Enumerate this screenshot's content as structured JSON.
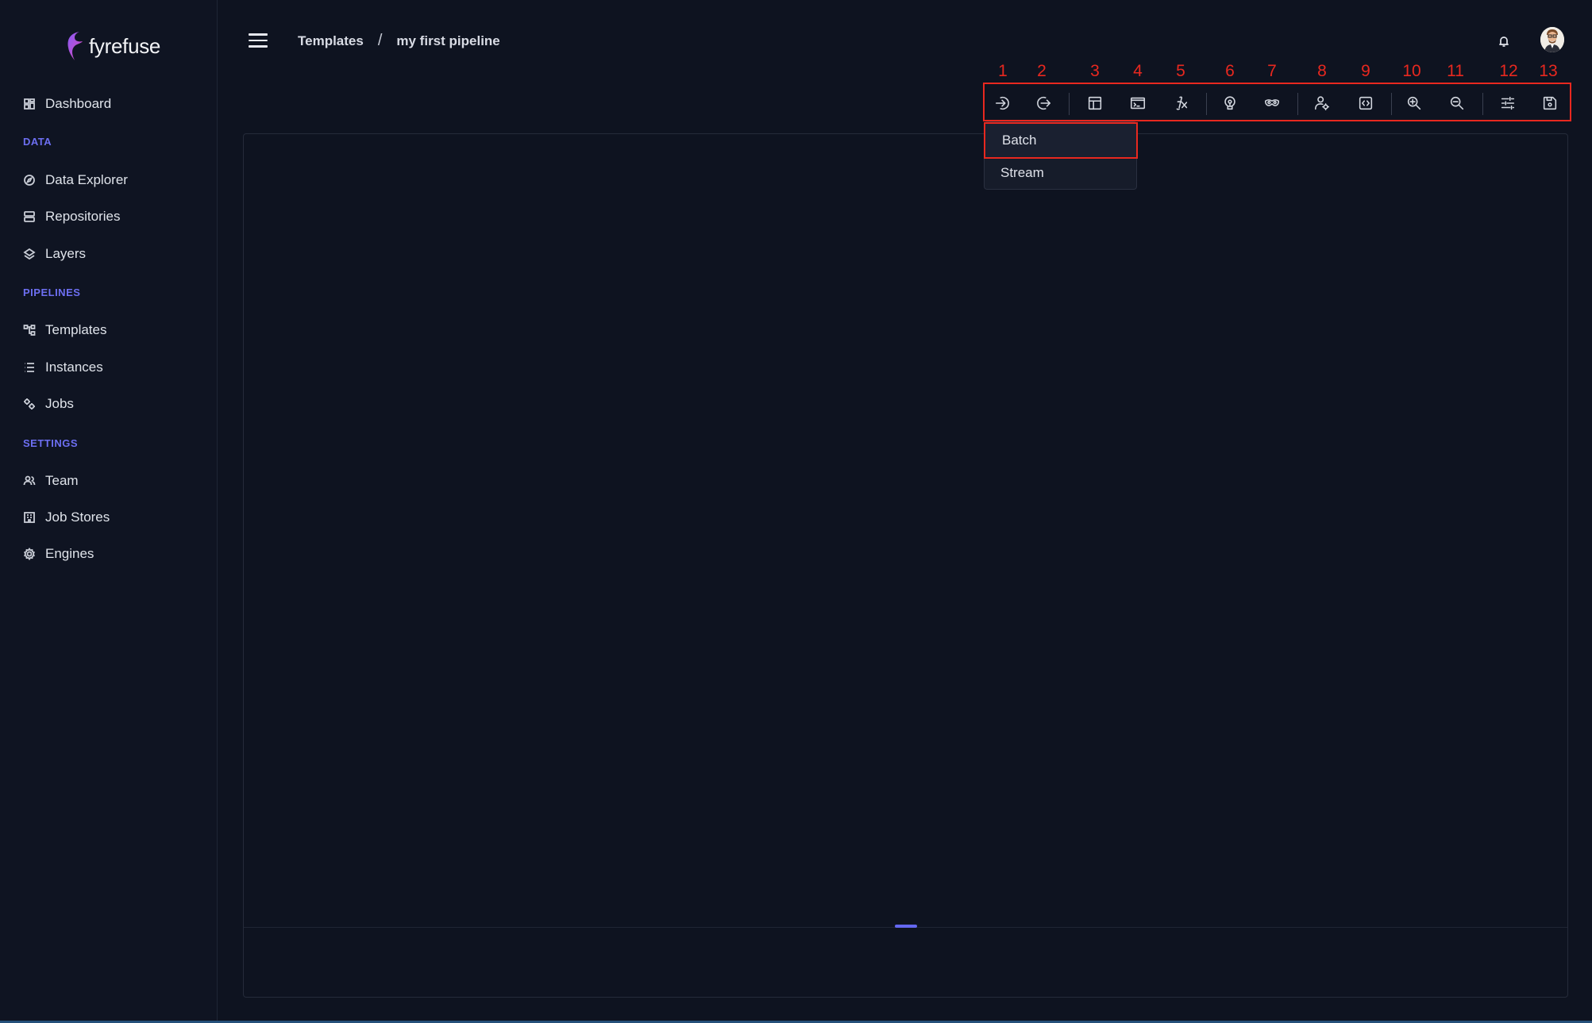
{
  "app": {
    "name": "fyrefuse"
  },
  "sidebar": {
    "dashboard": "Dashboard",
    "sections": {
      "data": "DATA",
      "pipelines": "PIPELINES",
      "settings": "SETTINGS"
    },
    "items": {
      "data_explorer": "Data Explorer",
      "repositories": "Repositories",
      "layers": "Layers",
      "templates": "Templates",
      "instances": "Instances",
      "jobs": "Jobs",
      "team": "Team",
      "job_stores": "Job Stores",
      "engines": "Engines"
    }
  },
  "header": {
    "breadcrumb_root": "Templates",
    "breadcrumb_sep": "/",
    "breadcrumb_current": "my first pipeline"
  },
  "toolbar": {
    "numbers": [
      "1",
      "2",
      "3",
      "4",
      "5",
      "6",
      "7",
      "8",
      "9",
      "10",
      "11",
      "12",
      "13"
    ],
    "icons": [
      "input-icon",
      "output-icon",
      "table-icon",
      "terminal-icon",
      "function-icon",
      "lightbulb-icon",
      "mask-icon",
      "user-settings-icon",
      "code-icon",
      "zoom-in-icon",
      "zoom-out-icon",
      "sliders-icon",
      "save-icon"
    ],
    "highlight_color": "#e8281f"
  },
  "dropdown": {
    "items": [
      "Batch",
      "Stream"
    ],
    "selected": "Batch"
  },
  "colors": {
    "background": "#0e1320",
    "accent": "#6d6ff2"
  }
}
